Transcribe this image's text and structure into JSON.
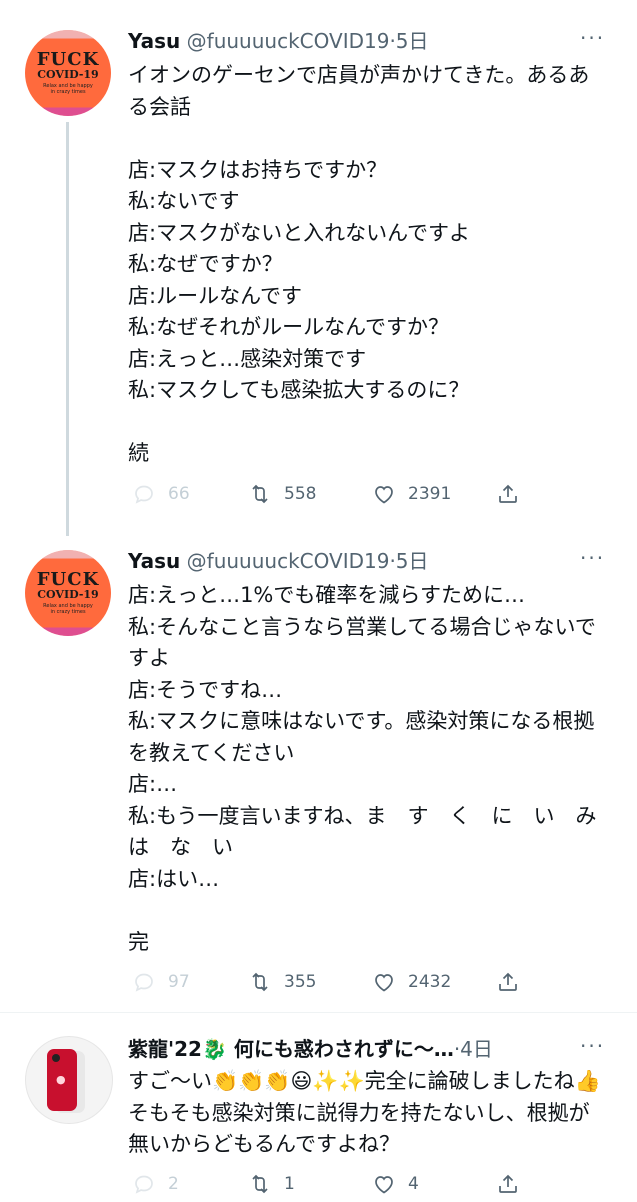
{
  "tweets": [
    {
      "name": "Yasu",
      "handle": "@fuuuuuckCOVID19",
      "time": "·5日",
      "avatar": {
        "line1": "FUCK",
        "line2": "COVID-19",
        "line3": "Relax and be happy in crazy times"
      },
      "text": "イオンのゲーセンで店員が声かけてきた。あるある会話\n\n店:マスクはお持ちですか？\n私:ないです\n店:マスクがないと入れないんですよ\n私:なぜですか？\n店:ルールなんです\n私:なぜそれがルールなんですか？\n店:えっと…感染対策です\n私:マスクしても感染拡大するのに？\n\n続",
      "replies": "66",
      "retweets": "558",
      "likes": "2391"
    },
    {
      "name": "Yasu",
      "handle": "@fuuuuuckCOVID19",
      "time": "·5日",
      "avatar": {
        "line1": "FUCK",
        "line2": "COVID-19",
        "line3": "Relax and be happy in crazy times"
      },
      "text": "店:えっと…1%でも確率を減らすために…\n私:そんなこと言うなら営業してる場合じゃないですよ\n店:そうですね…\n私:マスクに意味はないです。感染対策になる根拠を教えてください\n店:…\n私:もう一度言いますね、ま　す　く　に　い　み　は　な　い\n店:はい…\n\n完",
      "replies": "97",
      "retweets": "355",
      "likes": "2432"
    },
    {
      "name": "紫龍'22🐉 何にも惑わされずに〜…",
      "handle": "",
      "time": "·4日",
      "text": "すご〜い👏👏👏😃✨✨完全に論破しましたね👍そもそも感染対策に説得力を持たないし、根拠が無いからどもるんですよね？",
      "replies": "2",
      "retweets": "1",
      "likes": "4"
    }
  ],
  "more_label": "···",
  "icons": {
    "reply": "reply-icon",
    "retweet": "retweet-icon",
    "like": "like-icon",
    "share": "share-icon"
  }
}
